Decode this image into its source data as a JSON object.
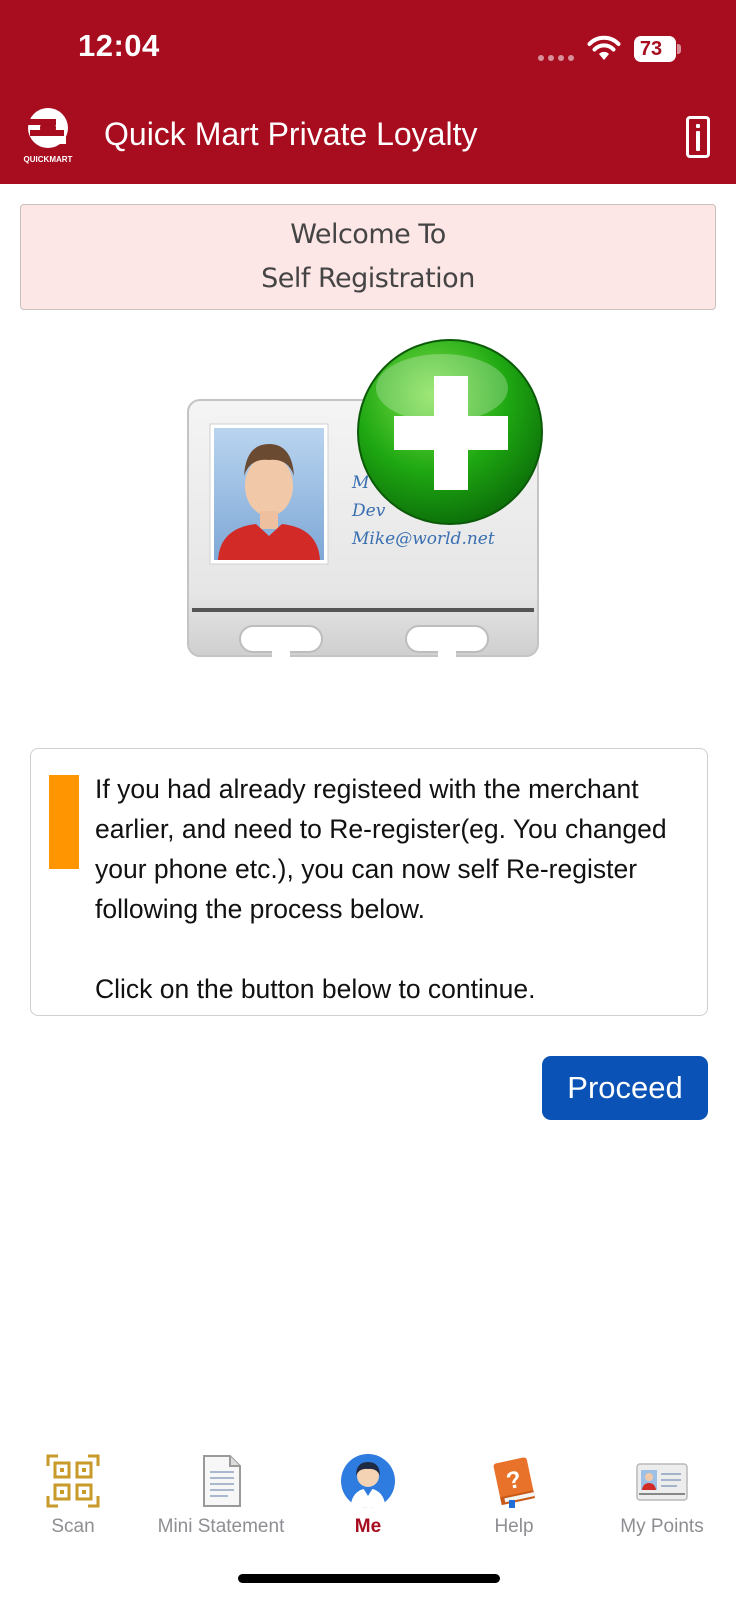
{
  "status_bar": {
    "time": "12:04",
    "battery_percent": "73"
  },
  "header": {
    "title": "Quick Mart Private Loyalty",
    "logo_text": "QUICKMART",
    "brand_color": "#a80c1f"
  },
  "welcome": {
    "line1": "Welcome To",
    "line2": "Self Registration"
  },
  "illustration": {
    "card_text_line1": "M",
    "card_text_line2": "Dev",
    "card_email": "Mike@world.net"
  },
  "info_box": {
    "paragraph1": "If you had already registeed with the merchant earlier, and need to Re-register(eg. You changed your phone etc.), you can now self Re-register following the process below.",
    "paragraph2": "Click on the button below to continue.",
    "accent_color": "#ff9500"
  },
  "proceed_button": {
    "label": "Proceed",
    "color": "#0a52b5"
  },
  "bottom_nav": {
    "items": [
      {
        "label": "Scan",
        "icon": "qr-code-icon"
      },
      {
        "label": "Mini Statement",
        "icon": "document-icon"
      },
      {
        "label": "Me",
        "icon": "user-avatar-icon",
        "active": true
      },
      {
        "label": "Help",
        "icon": "help-book-icon"
      },
      {
        "label": "My Points",
        "icon": "id-card-icon"
      }
    ]
  }
}
